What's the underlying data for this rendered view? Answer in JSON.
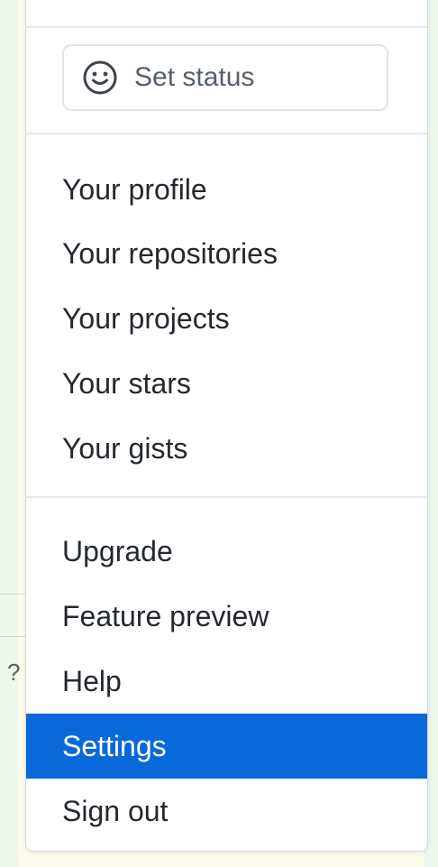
{
  "menu": {
    "header_text": "",
    "status": {
      "label": "Set status",
      "icon": "smiley-icon"
    },
    "group1": [
      {
        "label": "Your profile"
      },
      {
        "label": "Your repositories"
      },
      {
        "label": "Your projects"
      },
      {
        "label": "Your stars"
      },
      {
        "label": "Your gists"
      }
    ],
    "group2": [
      {
        "label": "Upgrade"
      },
      {
        "label": "Feature preview"
      },
      {
        "label": "Help"
      },
      {
        "label": "Settings",
        "active": true
      },
      {
        "label": "Sign out"
      }
    ]
  },
  "background": {
    "partial_glyph": "?"
  },
  "colors": {
    "accent": "#0969da",
    "text": "#24292f",
    "muted": "#57606a",
    "border": "#d0d7de"
  }
}
